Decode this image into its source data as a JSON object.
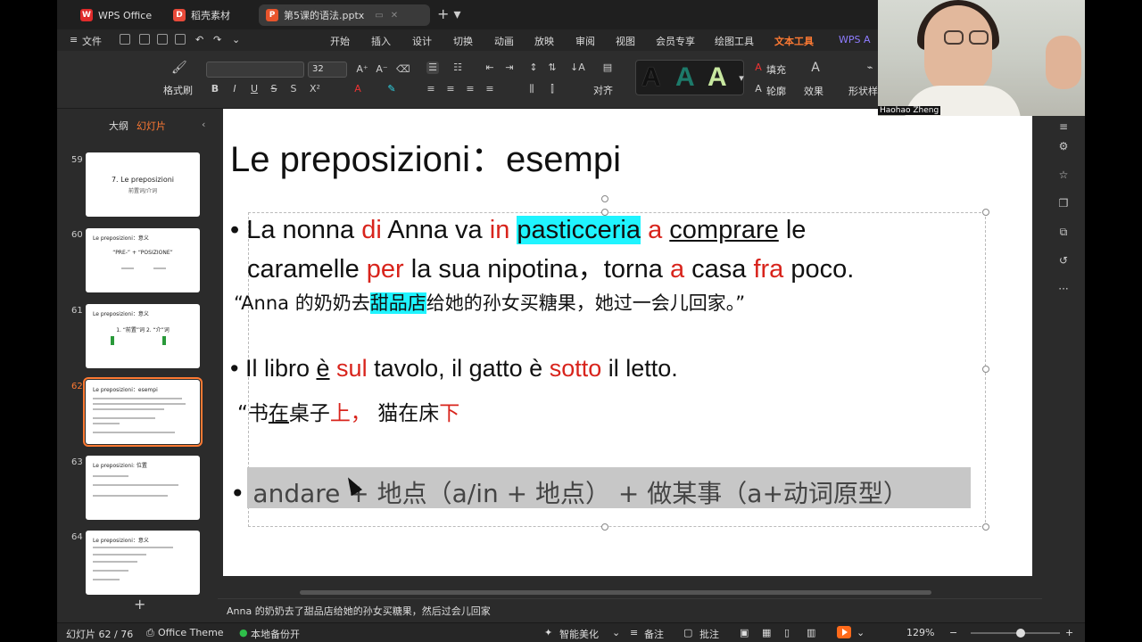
{
  "tabs": [
    {
      "label": "WPS Office",
      "icon": "wps-logo-icon"
    },
    {
      "label": "稻壳素材",
      "icon": "docer-icon"
    },
    {
      "label": "第5课的语法.pptx",
      "icon": "ppt-file-icon"
    }
  ],
  "menu": {
    "file": "文件",
    "items": [
      "开始",
      "插入",
      "设计",
      "切换",
      "动画",
      "放映",
      "审阅",
      "视图",
      "会员专享",
      "绘图工具",
      "文本工具",
      "WPS A"
    ],
    "active": "文本工具"
  },
  "ribbon": {
    "format_painter": "格式刷",
    "font_size": "32",
    "align_label": "对齐",
    "fill_label": "填充",
    "outline_label": "轮廓",
    "effect_label": "效果",
    "shape_style_label": "形状样",
    "text_style_sample": "A"
  },
  "left_panel": {
    "tab_outline": "大纲",
    "tab_slides": "幻灯片",
    "thumbnails": [
      {
        "num": "59",
        "title": "",
        "center": "7. Le preposizioni",
        "sub": "前置词/介词"
      },
      {
        "num": "60",
        "title": "Le preposizioni：意义",
        "center": "“PRE-” + “POSIZIONE”",
        "sub": ""
      },
      {
        "num": "61",
        "title": "Le preposizioni：意义",
        "center": "1. “前置”词   2. “介”词",
        "sub": ""
      },
      {
        "num": "62",
        "title": "Le preposizioni：esempi",
        "center": "",
        "sub": ""
      },
      {
        "num": "63",
        "title": "Le preposizioni: 位置",
        "center": "",
        "sub": ""
      },
      {
        "num": "64",
        "title": "Le preposizioni：意义",
        "center": "",
        "sub": ""
      }
    ]
  },
  "slide": {
    "title": "Le preposizioni：esempi",
    "line1": {
      "bullet": "•",
      "p1": "La nonna ",
      "r1": "di",
      "p2": " Anna va ",
      "r2": "in",
      "p3": " ",
      "hl": "pasticceria",
      "p4": " ",
      "r3": "a",
      "p5": " ",
      "ul": "comprare",
      "p6": " le"
    },
    "line2": {
      "p1": "caramelle ",
      "r1": "per",
      "p2": " la sua nipotina，torna ",
      "r2": "a",
      "p3": " casa ",
      "r3": "fra",
      "p4": " poco."
    },
    "line3": {
      "p1": "“Anna 的奶奶去",
      "hl": "甜品店",
      "p2": "给她的孙女买糖果，她过一会儿回家。”"
    },
    "line4": {
      "bullet": "•",
      "p1": "Il libro ",
      "ul": "è",
      "p2": " ",
      "r1": "sul",
      "p3": " tavolo, il gatto è ",
      "r2": "sotto",
      "p4": " il letto."
    },
    "line5": {
      "p1": "“书",
      "ul": "在",
      "p2": "桌子",
      "r1": "上，",
      "p3": " 猫在床",
      "r2": "下"
    },
    "line6": {
      "bullet": "•",
      "text": "andare + 地点（a/in + 地点） + 做某事（a+动词原型）"
    }
  },
  "notes": "Anna 的奶奶去了甜品店给她的孙女买糖果，然后过会儿回家",
  "status": {
    "slide_counter": "幻灯片 62 / 76",
    "theme": "Office Theme",
    "backup": "本地备份开",
    "beautify": "智能美化",
    "notes_btn": "备注",
    "comments_btn": "批注",
    "zoom": "129%"
  },
  "webcam": {
    "name": "Haohao Zheng"
  },
  "colors": {
    "accent": "#ff7a33",
    "red_text": "#d8241c",
    "highlight": "#1ff4ff"
  }
}
